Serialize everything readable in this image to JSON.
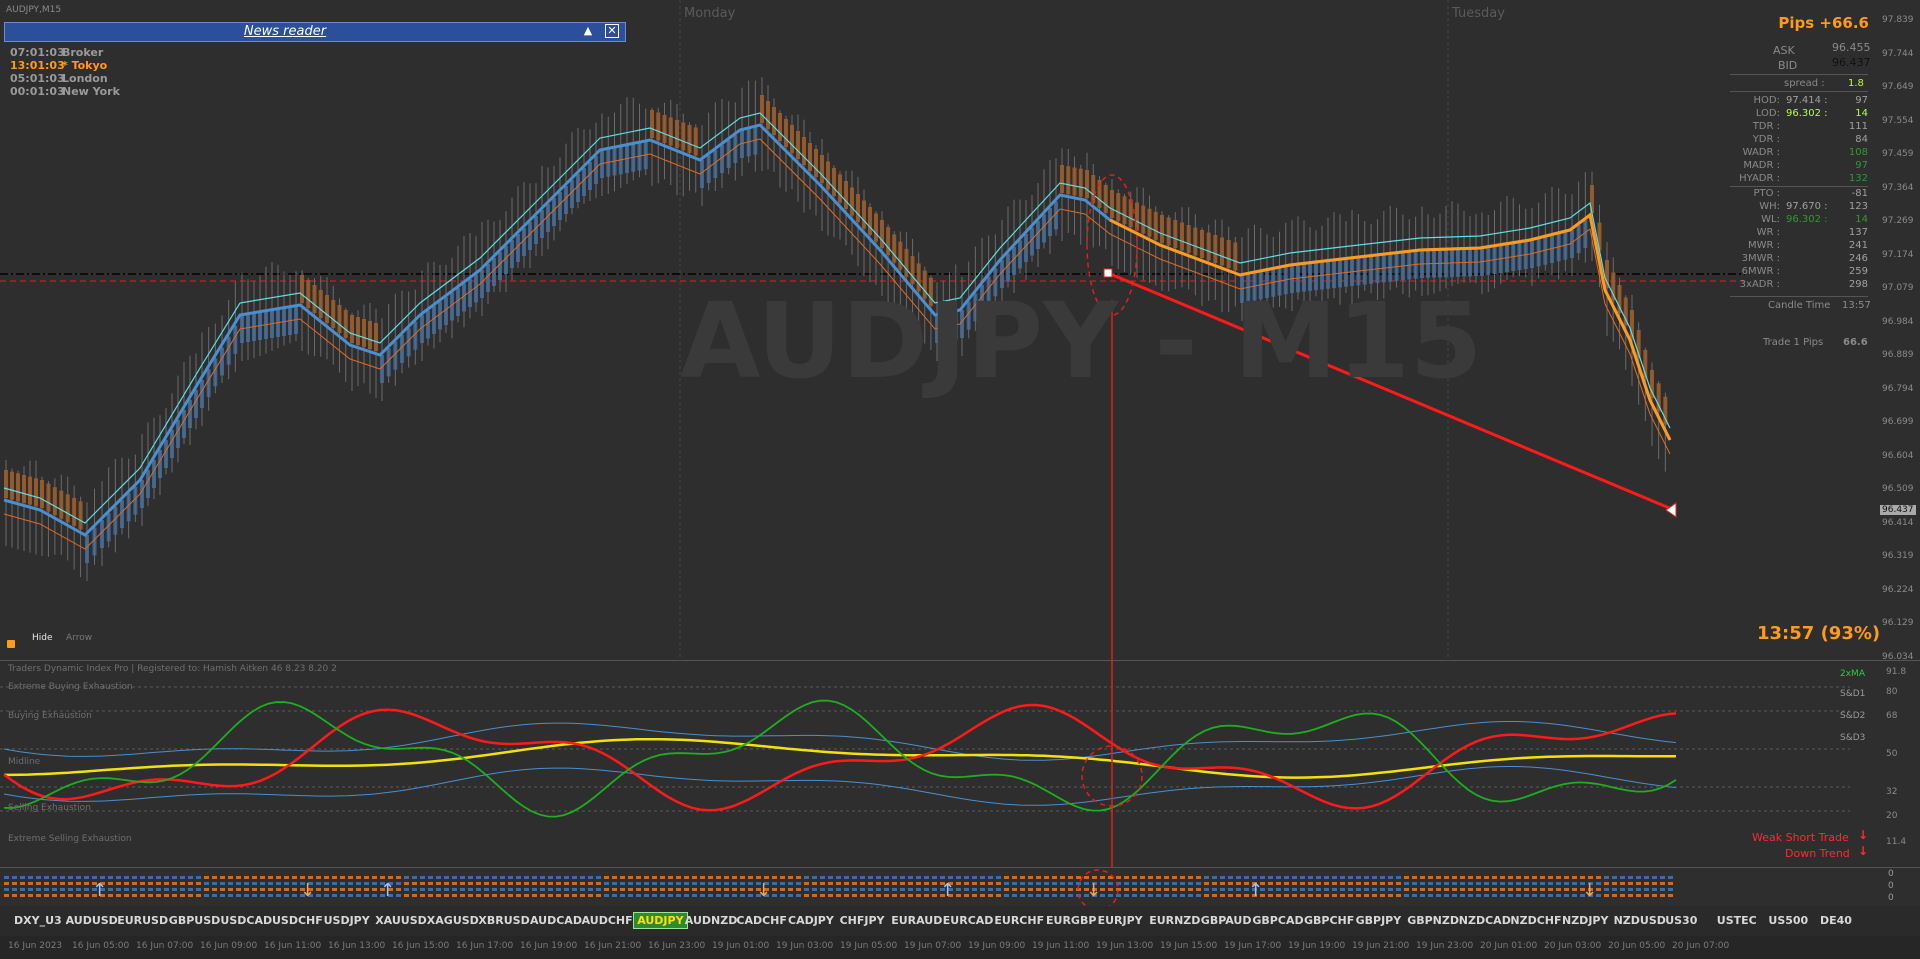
{
  "window": {
    "title": "AUDJPY,M15",
    "watermark": "AUDJPY - M15"
  },
  "day_labels": [
    "Monday",
    "Tuesday"
  ],
  "news_reader": {
    "title": "News reader",
    "min_icon": "triangle-up-icon",
    "close_icon": "close-icon"
  },
  "sessions": [
    {
      "time": "07:01:03",
      "name": "Broker",
      "color": "#9a9a9a"
    },
    {
      "time": "13:01:03",
      "name": "* Tokyo",
      "color": "#ff9a1a"
    },
    {
      "time": "05:01:03",
      "name": "London",
      "color": "#9a9a9a"
    },
    {
      "time": "00:01:03",
      "name": "New York",
      "color": "#9a9a9a"
    }
  ],
  "pips": "Pips +66.6",
  "quote": {
    "ask_label": "ASK",
    "ask": "96.455",
    "bid_label": "BID",
    "bid": "96.437",
    "spread_label": "spread :",
    "spread": "1.8"
  },
  "stats": [
    {
      "label": "HOD:",
      "value": "97.414 :",
      "extra": "97",
      "color": "#a0a0a0"
    },
    {
      "label": "LOD:",
      "value": "96.302 :",
      "extra": "14",
      "color": "#b8ff3a"
    },
    {
      "label": "TDR :",
      "value": "",
      "extra": "111",
      "color": "#a0a0a0"
    },
    {
      "label": "YDR :",
      "value": "",
      "extra": "84",
      "color": "#a0a0a0"
    },
    {
      "label": "WADR :",
      "value": "",
      "extra": "108",
      "color": "#2e9a2e"
    },
    {
      "label": "MADR :",
      "value": "",
      "extra": "97",
      "color": "#2e9a2e"
    },
    {
      "label": "HYADR :",
      "value": "",
      "extra": "132",
      "color": "#2e9a2e"
    }
  ],
  "stats2": [
    {
      "label": "PTO :",
      "value": "",
      "extra": "-81",
      "color": "#a0a0a0"
    },
    {
      "label": "WH:",
      "value": "97.670 :",
      "extra": "123",
      "color": "#a0a0a0"
    },
    {
      "label": "WL:",
      "value": "96.302 :",
      "extra": "14",
      "color": "#2e9a2e"
    },
    {
      "label": "WR :",
      "value": "",
      "extra": "137",
      "color": "#a0a0a0"
    },
    {
      "label": "MWR :",
      "value": "",
      "extra": "241",
      "color": "#a0a0a0"
    },
    {
      "label": "3MWR :",
      "value": "",
      "extra": "246",
      "color": "#a0a0a0"
    },
    {
      "label": "6MWR :",
      "value": "",
      "extra": "259",
      "color": "#a0a0a0"
    },
    {
      "label": "3xADR :",
      "value": "",
      "extra": "298",
      "color": "#a0a0a0"
    }
  ],
  "candle_time": {
    "label": "Candle Time",
    "value": "13:57"
  },
  "trade": {
    "label": "Trade 1 Pips",
    "value": "66.6"
  },
  "countdown": "13:57 (93%)",
  "hide_label": "Hide",
  "arrow_label": "Arrow",
  "price_axis": [
    "97.839",
    "97.744",
    "97.649",
    "97.554",
    "97.459",
    "97.364",
    "97.269",
    "97.174",
    "97.079",
    "96.984",
    "96.889",
    "96.794",
    "96.699",
    "96.604",
    "96.509",
    "96.414",
    "96.319",
    "96.224",
    "96.129",
    "96.034"
  ],
  "current_price_tag": "96.437",
  "ind": {
    "title": "Traders Dynamic Index Pro | Registered to: Hamish Aitken 46 8.23 8.20 2",
    "labels": [
      "Extreme Buying Exhaustion",
      "Buying Exhaustion",
      "Midline",
      "Selling Exhaustion",
      "Extreme Selling Exhaustion"
    ],
    "right_labels": [
      "2xMA",
      "S&D1",
      "S&D2",
      "S&D3"
    ],
    "axis": [
      "91.8",
      "80",
      "68",
      "50",
      "32",
      "20",
      "11.4"
    ],
    "weak_short": "Weak Short Trade",
    "down_trend": "Down Trend"
  },
  "sig_axis": [
    "0",
    "0",
    "0"
  ],
  "symbols": [
    "DXY_U3",
    "AUDUSD",
    "EURUSD",
    "GBPUSD",
    "USDCAD",
    "USDCHF",
    "USDJPY",
    "XAUUSD",
    "XAGUSD",
    "XBRUSD",
    "AUDCAD",
    "AUDCHF",
    "AUDJPY",
    "AUDNZD",
    "CADCHF",
    "CADJPY",
    "CHFJPY",
    "EURAUD",
    "EURCAD",
    "EURCHF",
    "EURGBP",
    "EURJPY",
    "EURNZD",
    "GBPAUD",
    "GBPCAD",
    "GBPCHF",
    "GBPJPY",
    "GBPNZD",
    "NZDCAD",
    "NZDCHF",
    "NZDJPY",
    "NZDUSD",
    "US30",
    "USTEC",
    "US500",
    "DE40"
  ],
  "active_symbol": "AUDJPY",
  "time_axis": [
    "16 Jun 2023",
    "16 Jun 05:00",
    "16 Jun 07:00",
    "16 Jun 09:00",
    "16 Jun 11:00",
    "16 Jun 13:00",
    "16 Jun 15:00",
    "16 Jun 17:00",
    "16 Jun 19:00",
    "16 Jun 21:00",
    "16 Jun 23:00",
    "19 Jun 01:00",
    "19 Jun 03:00",
    "19 Jun 05:00",
    "19 Jun 07:00",
    "19 Jun 09:00",
    "19 Jun 11:00",
    "19 Jun 13:00",
    "19 Jun 15:00",
    "19 Jun 17:00",
    "19 Jun 19:00",
    "19 Jun 21:00",
    "19 Jun 23:00",
    "20 Jun 01:00",
    "20 Jun 03:00",
    "20 Jun 05:00",
    "20 Jun 07:00"
  ]
}
